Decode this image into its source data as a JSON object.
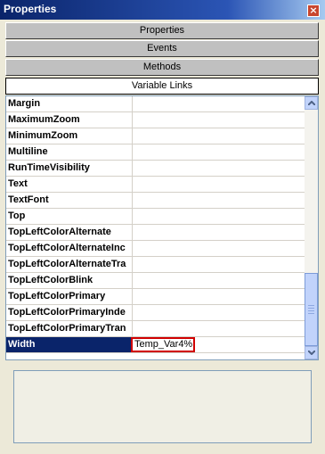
{
  "window": {
    "title": "Properties"
  },
  "tabs": [
    {
      "label": "Properties"
    },
    {
      "label": "Events"
    },
    {
      "label": "Methods"
    },
    {
      "label": "Variable Links"
    }
  ],
  "properties": [
    {
      "name": "Margin",
      "value": ""
    },
    {
      "name": "MaximumZoom",
      "value": ""
    },
    {
      "name": "MinimumZoom",
      "value": ""
    },
    {
      "name": "Multiline",
      "value": ""
    },
    {
      "name": "RunTimeVisibility",
      "value": ""
    },
    {
      "name": "Text",
      "value": ""
    },
    {
      "name": "TextFont",
      "value": ""
    },
    {
      "name": "Top",
      "value": ""
    },
    {
      "name": "TopLeftColorAlternate",
      "value": ""
    },
    {
      "name": "TopLeftColorAlternateInc",
      "value": ""
    },
    {
      "name": "TopLeftColorAlternateTra",
      "value": ""
    },
    {
      "name": "TopLeftColorBlink",
      "value": ""
    },
    {
      "name": "TopLeftColorPrimary",
      "value": ""
    },
    {
      "name": "TopLeftColorPrimaryInde",
      "value": ""
    },
    {
      "name": "TopLeftColorPrimaryTran",
      "value": ""
    },
    {
      "name": "Width",
      "value": "Temp_Var4%"
    }
  ],
  "selected_property": "Width",
  "scroll": {
    "position": 0.8
  },
  "colors": {
    "title_bar": "#0a246a",
    "selection": "#0a246a",
    "edit_border": "#d00000",
    "panel": "#ece9d8"
  }
}
